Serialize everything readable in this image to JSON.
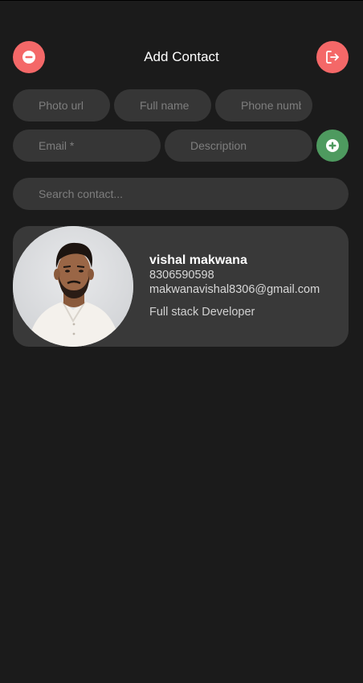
{
  "header": {
    "title": "Add Contact",
    "left_icon": "minus-circle-icon",
    "right_icon": "logout-icon"
  },
  "form": {
    "photo_placeholder": "Photo url",
    "name_placeholder": "Full name",
    "phone_placeholder": "Phone number",
    "email_placeholder": "Email *",
    "description_placeholder": "Description",
    "add_icon": "plus-circle-icon"
  },
  "search": {
    "placeholder": "Search contact..."
  },
  "contacts": [
    {
      "name": "vishal makwana",
      "phone": "8306590598",
      "email": "makwanavishal8306@gmail.com",
      "description": "Full stack Developer"
    }
  ],
  "colors": {
    "background": "#1b1b1b",
    "field": "#363636",
    "card": "#393939",
    "accent_red": "#f46868",
    "accent_green": "#4e9a5f"
  }
}
